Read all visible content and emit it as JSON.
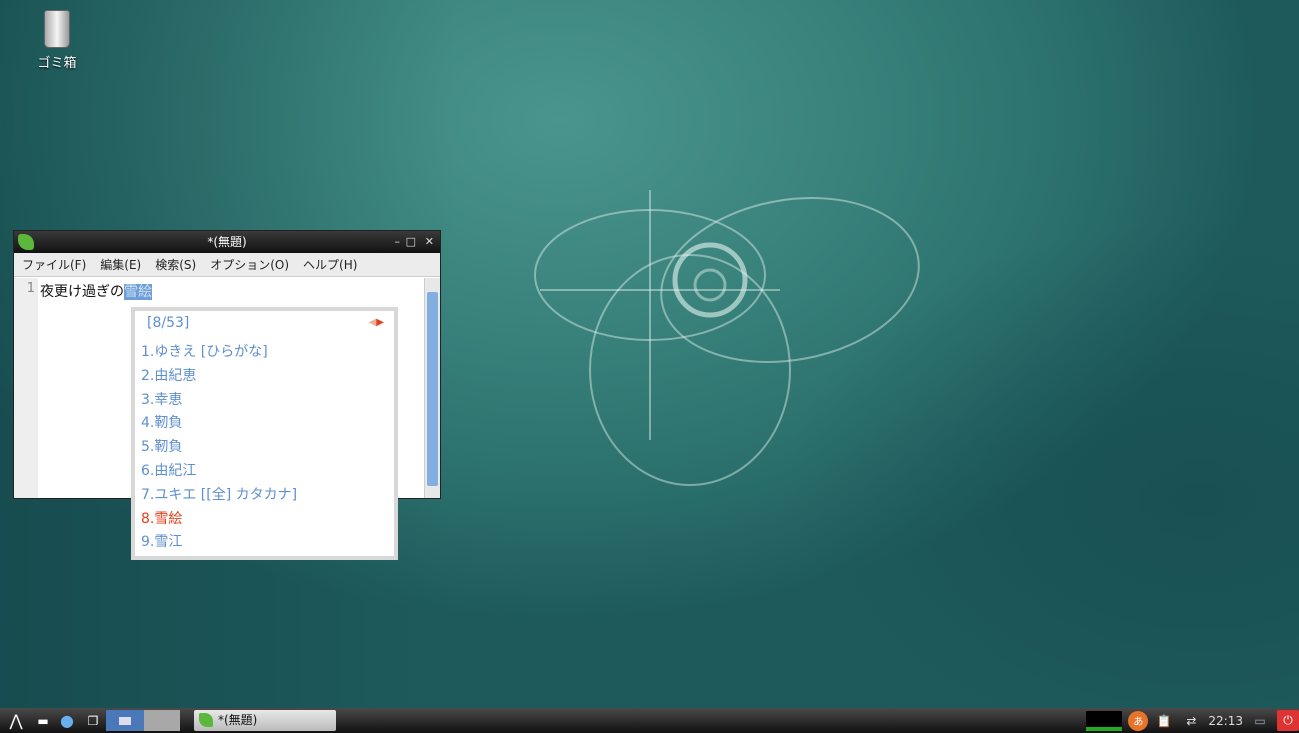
{
  "desktop": {
    "trash_label": "ゴミ箱"
  },
  "window": {
    "title": "*(無題)",
    "menu": [
      "ファイル(F)",
      "編集(E)",
      "検索(S)",
      "オプション(O)",
      "ヘルプ(H)"
    ],
    "line_number": "1",
    "text_before": "夜更け過ぎの",
    "text_selected": "雪絵"
  },
  "ime": {
    "page": "[8/53]",
    "candidates": [
      "1.ゆきえ [ひらがな]",
      "2.由紀恵",
      "3.幸恵",
      "4.靭負",
      "5.靭負",
      "6.由紀江",
      "7.ユキエ [[全] カタカナ]",
      "8.雪絵",
      "9.雪江"
    ],
    "selected_index": 7
  },
  "taskbar": {
    "task_label": "*(無題)",
    "clock": "22:13"
  },
  "colors": {
    "accent": "#6e9ed8",
    "selected_candidate": "#e5401c"
  }
}
